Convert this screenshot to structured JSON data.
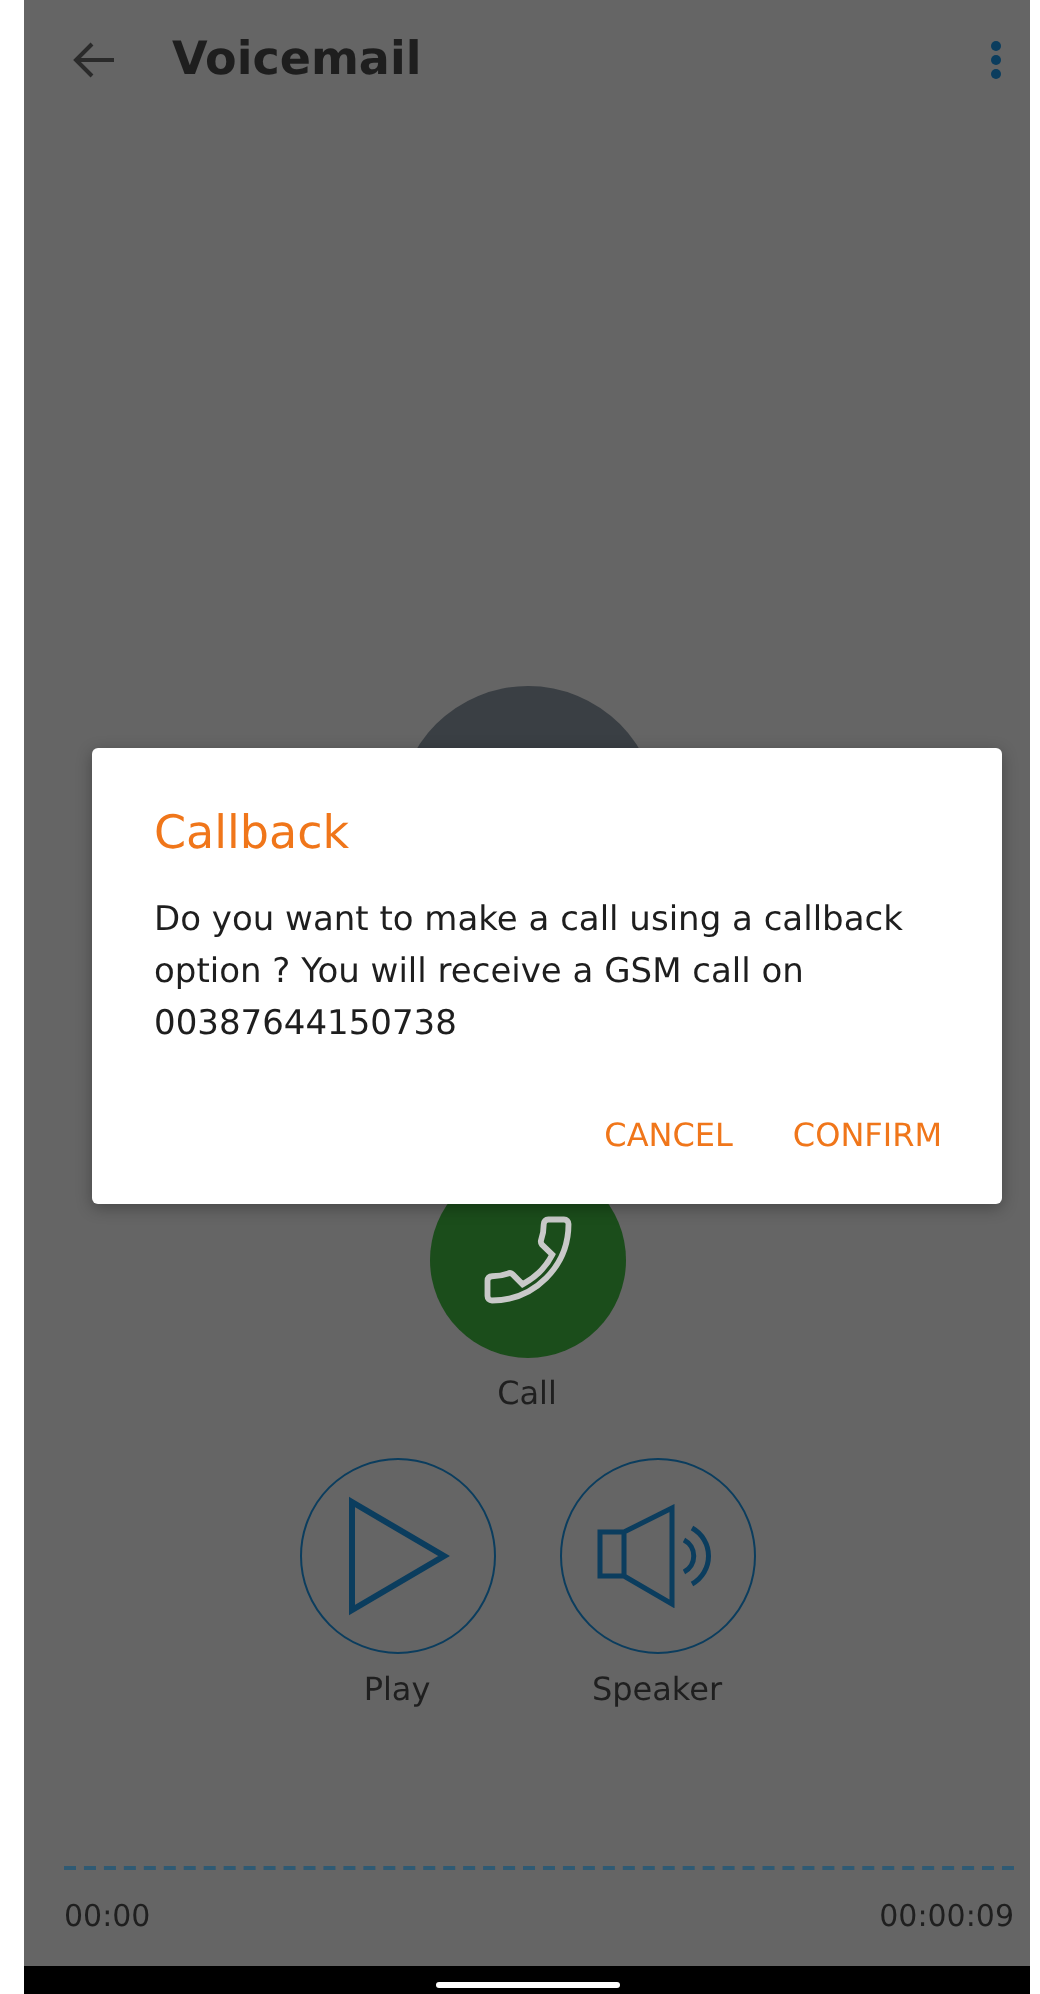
{
  "app_bar": {
    "title": "Voicemail"
  },
  "actions": [
    {
      "kind": "call",
      "label": "Call"
    },
    {
      "kind": "play",
      "label": "Play"
    },
    {
      "kind": "speaker",
      "label": "Speaker"
    }
  ],
  "player": {
    "elapsed": "00:00",
    "duration": "00:00:09"
  },
  "dialog": {
    "title": "Callback",
    "message": "Do you want to make a call using a callback option ? You will receive a GSM call on 00387644150738",
    "buttons": [
      "CANCEL",
      "CONFIRM"
    ]
  }
}
